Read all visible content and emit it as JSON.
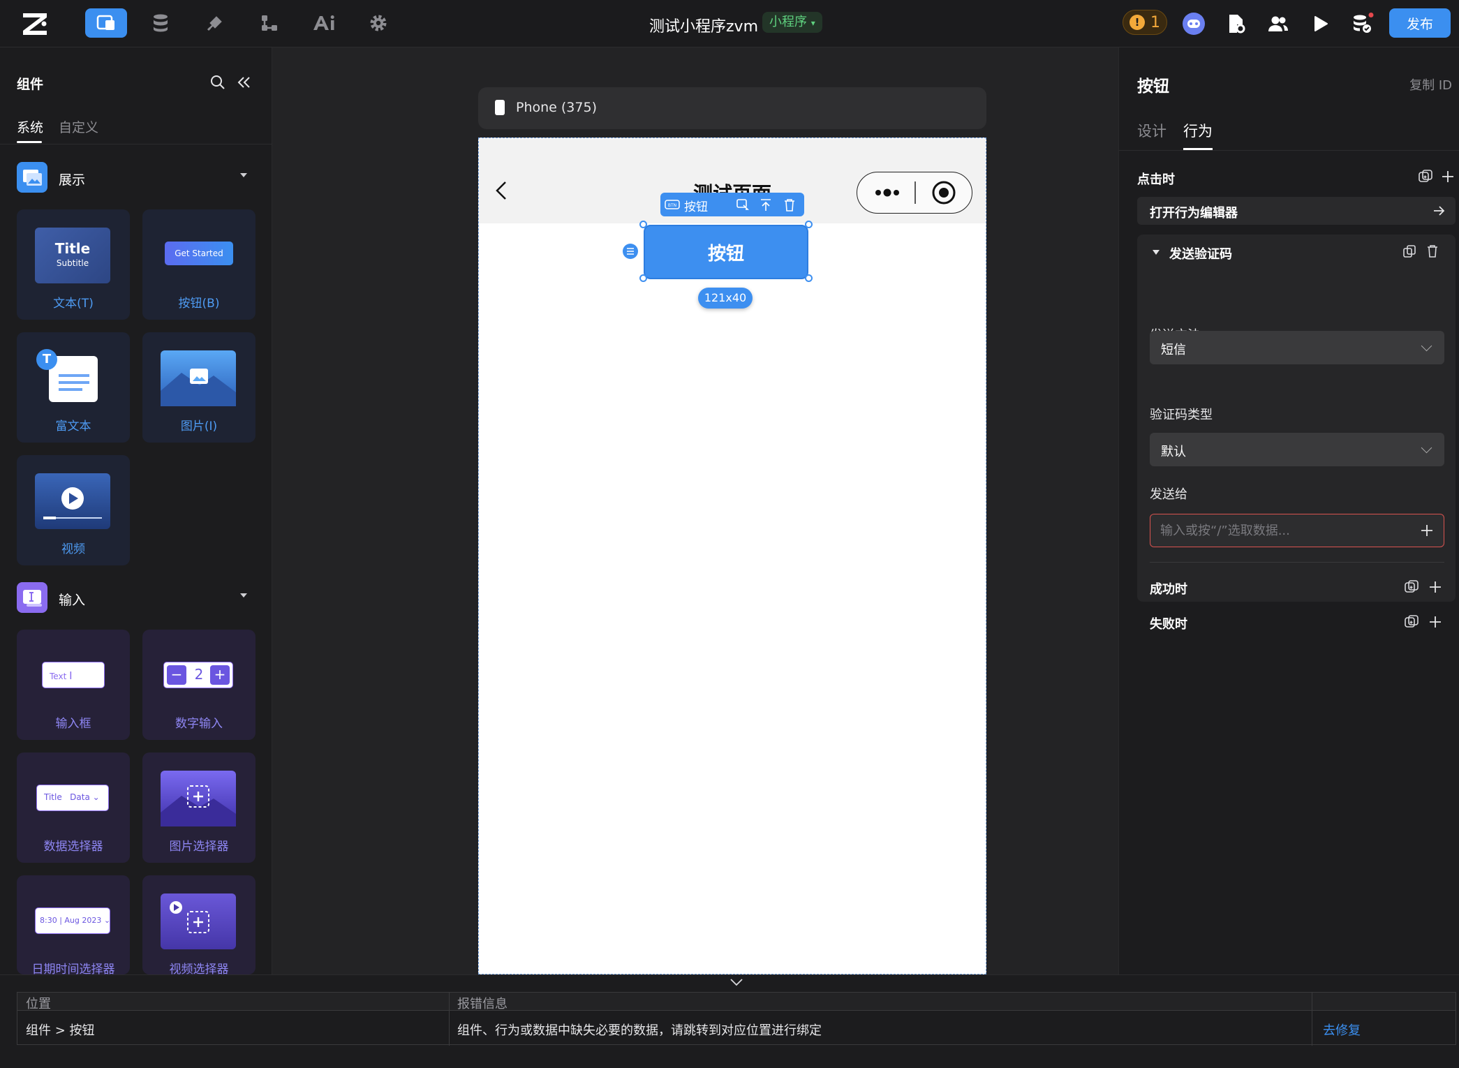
{
  "app": {
    "doc_title": "测试小程序zvm",
    "env_badge": "小程序",
    "warning_count": "1",
    "publish_label": "发布"
  },
  "left_panel": {
    "title": "组件",
    "tabs": [
      "系统",
      "自定义"
    ],
    "sections": {
      "display": {
        "title": "展示",
        "items": [
          "文本(T)",
          "按钮(B)",
          "富文本",
          "图片(I)",
          "视频"
        ]
      },
      "input": {
        "title": "输入",
        "items": [
          "输入框",
          "数字输入",
          "数据选择器",
          "图片选择器",
          "日期时间选择器",
          "视频选择器"
        ]
      }
    },
    "thumbs": {
      "text_title": "Title",
      "text_subtitle": "Subtitle",
      "button_text": "Get Started",
      "rich_text_letter": "T",
      "input_text": "Text",
      "number_value": "2",
      "select_title": "Title",
      "select_data": "Data",
      "time_text": "8:30",
      "date_text": "Aug 2023"
    }
  },
  "canvas": {
    "device": "Phone (375)",
    "page_title": "测试页面",
    "selected_button": "按钮",
    "toolbar_label": "按钮",
    "size_tag": "121x40"
  },
  "right_panel": {
    "title": "按钮",
    "copy_id": "复制 ID",
    "tabs": [
      "设计",
      "行为"
    ],
    "on_click_label": "点击时",
    "open_editor": "打开行为编辑器",
    "action": {
      "title": "发送验证码",
      "method_label": "发送方法",
      "method_value": "短信",
      "code_type_label": "验证码类型",
      "code_type_value": "默认",
      "send_to_label": "发送给",
      "send_to_placeholder": "输入或按“/”选取数据...",
      "on_success": "成功时",
      "on_fail": "失败时"
    }
  },
  "error_panel": {
    "headers": [
      "位置",
      "报错信息"
    ],
    "rows": [
      {
        "location": "组件 > 按钮",
        "message": "组件、行为或数据中缺失必要的数据，请跳转到对应位置进行绑定",
        "action": "去修复"
      }
    ]
  },
  "colors": {
    "accent": "#3b8ff0",
    "warning": "#f3a93a",
    "error_border": "#d9534f",
    "badge_green": "#5fd17f"
  }
}
